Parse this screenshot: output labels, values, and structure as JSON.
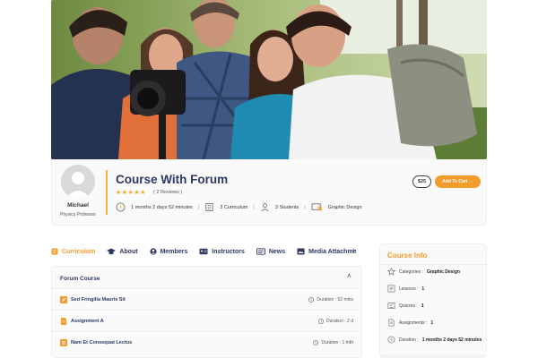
{
  "instructor": {
    "name": "Michael",
    "role": "Physics Professor"
  },
  "course": {
    "title": "Course With Forum",
    "rating": 4.5,
    "stars": "★★★★★",
    "reviews": "( 2 Reviews )",
    "duration": "1 months 2 days 52 minutes",
    "curriculum": "3 Curriculum",
    "students": "3 Students",
    "category": "Graphic Design",
    "price": "$25",
    "cart_label": "Add To Cart →"
  },
  "tabs": [
    {
      "label": "Curriculum",
      "icon": "book-icon",
      "active": true
    },
    {
      "label": "About",
      "icon": "cap-icon",
      "active": false
    },
    {
      "label": "Members",
      "icon": "user-icon",
      "active": false
    },
    {
      "label": "Instructors",
      "icon": "id-card-icon",
      "active": false
    },
    {
      "label": "News",
      "icon": "newspaper-icon",
      "active": false
    },
    {
      "label": "Media Attachme",
      "icon": "image-icon",
      "active": false
    }
  ],
  "tab_scroll": "›",
  "curriculum": {
    "section_title": "Forum Course",
    "collapse": "˄",
    "lessons": [
      {
        "title": "Sed Fringilla Mauris Sit",
        "duration": "Duration : 52 mins",
        "icon": "edit-icon"
      },
      {
        "title": "Assignment A",
        "duration": "Duration : 2 d",
        "icon": "file-icon"
      },
      {
        "title": "Nam Et Consequat Lectus",
        "duration": "Duration : 1 mth",
        "icon": "list-icon"
      }
    ]
  },
  "course_info": {
    "title": "Course Info",
    "rows": [
      {
        "label": "Categories :",
        "value": "Graphic Design",
        "icon": "star-outline-icon"
      },
      {
        "label": "Lessons :",
        "value": "1",
        "icon": "lessons-icon"
      },
      {
        "label": "Quizzes :",
        "value": "1",
        "icon": "quiz-icon"
      },
      {
        "label": "Assignments :",
        "value": "1",
        "icon": "assignment-icon"
      },
      {
        "label": "Duration :",
        "value": "1 months 2 days 52 minutes",
        "icon": "clock-icon"
      }
    ]
  },
  "colors": {
    "accent": "#f39c2c",
    "navy": "#2f3763",
    "star": "#f5a623"
  }
}
